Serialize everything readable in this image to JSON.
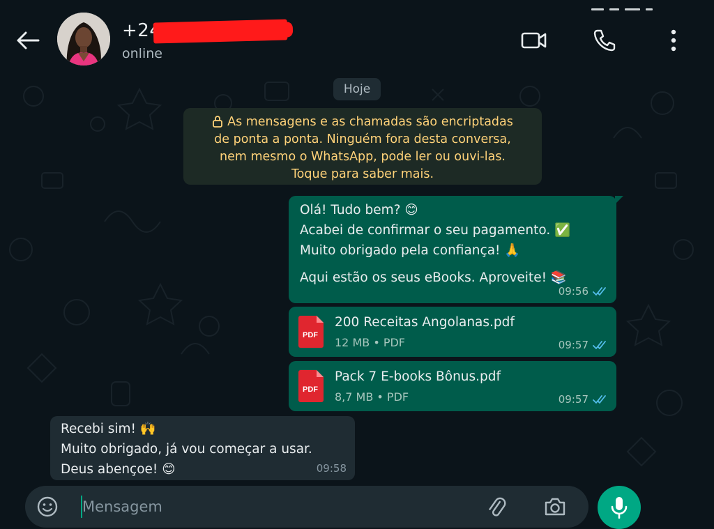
{
  "header": {
    "contact_name": "+244",
    "contact_status": "online",
    "icons": [
      "back-arrow-icon",
      "video-call-icon",
      "voice-call-icon",
      "more-vert-icon"
    ]
  },
  "chat": {
    "date_chip": "Hoje",
    "encryption_notice": {
      "line1": "As mensagens e as chamadas são encriptadas",
      "line2": "de ponta a ponta. Ninguém fora desta conversa,",
      "line3": "nem mesmo o WhatsApp, pode ler ou ouvi-las.",
      "line4": "Toque para saber mais."
    },
    "messages": [
      {
        "direction": "outgoing",
        "lines": [
          "Olá! Tudo bem? 😊",
          "Acabei de confirmar o seu pagamento. ✅",
          "Muito obrigado pela confiança! 🙏",
          "Aqui estão os seus eBooks. Aproveite! 📚"
        ],
        "time": "09:56",
        "status": "read"
      },
      {
        "direction": "outgoing",
        "type": "document",
        "icon_label": "PDF",
        "file_name": "200 Receitas Angolanas.pdf",
        "file_info": "12 MB • PDF",
        "time": "09:57",
        "status": "read"
      },
      {
        "direction": "outgoing",
        "type": "document",
        "icon_label": "PDF",
        "file_name": "Pack 7 E-books Bônus.pdf",
        "file_info": "8,7 MB • PDF",
        "time": "09:57",
        "status": "read"
      },
      {
        "direction": "incoming",
        "lines": [
          "Recebi sim! 🙌",
          "Muito obrigado, já vou começar a usar.",
          "Deus abençoe! 😊"
        ],
        "time": "09:58"
      }
    ]
  },
  "composer": {
    "placeholder": "Mensagem",
    "icons": [
      "emoji-icon",
      "attach-icon",
      "camera-icon",
      "mic-icon"
    ]
  },
  "colors": {
    "background": "#0b141a",
    "outgoing_bubble": "#005c4b",
    "incoming_bubble": "#1f2c33",
    "accent": "#00a884",
    "read_ticks": "#53bdeb",
    "notice_text": "#ffd279",
    "pdf_red": "#e0262f",
    "redaction": "#ff1a1a"
  }
}
